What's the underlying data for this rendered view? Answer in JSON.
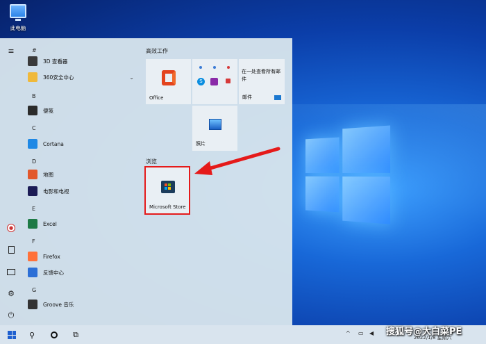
{
  "desktop": {
    "this_pc_label": "此电脑"
  },
  "start_menu": {
    "rail_icons": [
      "hamburger-icon",
      "user-icon",
      "document-icon",
      "pictures-icon",
      "settings-icon",
      "power-icon"
    ],
    "app_list": [
      {
        "type": "letter",
        "text": "#"
      },
      {
        "type": "app",
        "name": "3D 查看器",
        "icon": "3d-viewer-icon",
        "color": "#3a3a3a"
      },
      {
        "type": "app",
        "name": "360安全中心",
        "icon": "folder-icon",
        "color": "#f0b93a",
        "expandable": true
      },
      {
        "type": "letter",
        "text": "B"
      },
      {
        "type": "app",
        "name": "便笺",
        "icon": "sticky-notes-icon",
        "color": "#2b2b2b"
      },
      {
        "type": "letter",
        "text": "C"
      },
      {
        "type": "app",
        "name": "Cortana",
        "icon": "cortana-icon",
        "color": "#1e88e5"
      },
      {
        "type": "letter",
        "text": "D"
      },
      {
        "type": "app",
        "name": "地图",
        "icon": "maps-icon",
        "color": "#e2572b"
      },
      {
        "type": "app",
        "name": "电影和电视",
        "icon": "movies-tv-icon",
        "color": "#1b1b55"
      },
      {
        "type": "letter",
        "text": "E"
      },
      {
        "type": "app",
        "name": "Excel",
        "icon": "excel-icon",
        "color": "#1d7a45"
      },
      {
        "type": "letter",
        "text": "F"
      },
      {
        "type": "app",
        "name": "Firefox",
        "icon": "firefox-icon",
        "color": "#ff7139"
      },
      {
        "type": "app",
        "name": "反馈中心",
        "icon": "feedback-hub-icon",
        "color": "#2c6fd6"
      },
      {
        "type": "letter",
        "text": "G"
      },
      {
        "type": "app",
        "name": "Groove 音乐",
        "icon": "groove-music-icon",
        "color": "#333333"
      }
    ],
    "group_productivity": {
      "title": "高效工作",
      "office_label": "Office",
      "mail_text": "在一处查看所有邮件",
      "mail_label": "邮件",
      "photos_label": "照片"
    },
    "group_browse": {
      "title": "浏览",
      "store_label": "Microsoft Store"
    },
    "annotation_color": "#e51a1a"
  },
  "taskbar": {
    "clock_date": "2022/1/8 星期六",
    "tray_chevron": "^"
  },
  "watermark": "搜狐号@大白菜PE"
}
